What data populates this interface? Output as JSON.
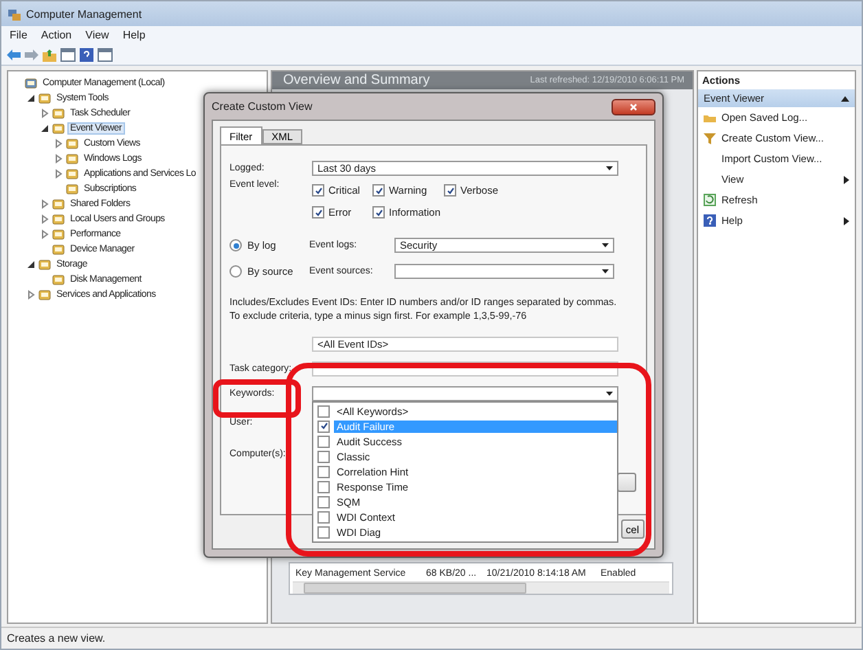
{
  "window": {
    "title": "Computer Management"
  },
  "menu": [
    "File",
    "Action",
    "View",
    "Help"
  ],
  "tree": [
    {
      "label": "Computer Management (Local)",
      "selected": false,
      "children": [
        {
          "label": "System Tools",
          "selected": false,
          "expanded": true,
          "children": [
            {
              "label": "Task Scheduler",
              "selected": false,
              "expanded": false
            },
            {
              "label": "Event Viewer",
              "selected": true,
              "expanded": true,
              "children": [
                {
                  "label": "Custom Views",
                  "selected": false,
                  "expanded": false
                },
                {
                  "label": "Windows Logs",
                  "selected": false,
                  "expanded": false
                },
                {
                  "label": "Applications and Services Lo",
                  "selected": false,
                  "expanded": false
                },
                {
                  "label": "Subscriptions",
                  "selected": false
                }
              ]
            },
            {
              "label": "Shared Folders",
              "selected": false,
              "expanded": false
            },
            {
              "label": "Local Users and Groups",
              "selected": false,
              "expanded": false
            },
            {
              "label": "Performance",
              "selected": false,
              "expanded": false
            },
            {
              "label": "Device Manager",
              "selected": false
            }
          ]
        },
        {
          "label": "Storage",
          "selected": false,
          "expanded": true,
          "children": [
            {
              "label": "Disk Management",
              "selected": false
            }
          ]
        },
        {
          "label": "Services and Applications",
          "selected": false,
          "expanded": false
        }
      ]
    }
  ],
  "center": {
    "title": "Overview and Summary",
    "refreshed": "Last refreshed: 12/19/2010 6:06:11 PM",
    "table_row": [
      "Key Management Service",
      "68 KB/20 ...",
      "10/21/2010 8:14:18 AM",
      "Enabled"
    ]
  },
  "dialog": {
    "title": "Create Custom View",
    "tabs": [
      {
        "label": "Filter",
        "selected": true
      },
      {
        "label": "XML",
        "selected": false
      }
    ],
    "logged": {
      "label": "Logged:",
      "value": "Last 30 days"
    },
    "event_level": {
      "label": "Event level:",
      "options": [
        {
          "label": "Critical",
          "checked": true
        },
        {
          "label": "Warning",
          "checked": true
        },
        {
          "label": "Verbose",
          "checked": true
        },
        {
          "label": "Error",
          "checked": true
        },
        {
          "label": "Information",
          "checked": true
        }
      ]
    },
    "sources": [
      {
        "label": "By log",
        "selected": true,
        "field_label": "Event logs:",
        "value": "Security"
      },
      {
        "label": "By source",
        "selected": false,
        "field_label": "Event sources:"
      }
    ],
    "description": "Includes/Excludes Event IDs: Enter ID numbers and/or ID ranges separated by commas. To exclude criteria, type a minus sign first. For example 1,3,5-99,-76",
    "event_ids": {
      "value": "<All Event IDs>"
    },
    "task_category": {
      "label": "Task category:"
    },
    "keywords": {
      "label": "Keywords:",
      "options": [
        {
          "label": "<All Keywords>",
          "checked": false,
          "selected": false
        },
        {
          "label": "Audit Failure",
          "checked": true,
          "selected": true
        },
        {
          "label": "Audit Success",
          "checked": false,
          "selected": false
        },
        {
          "label": "Classic",
          "checked": false,
          "selected": false
        },
        {
          "label": "Correlation Hint",
          "checked": false,
          "selected": false
        },
        {
          "label": "Response Time",
          "checked": false,
          "selected": false
        },
        {
          "label": "SQM",
          "checked": false,
          "selected": false
        },
        {
          "label": "WDI Context",
          "checked": false,
          "selected": false
        },
        {
          "label": "WDI Diag",
          "checked": false,
          "selected": false
        }
      ]
    },
    "user": {
      "label": "User:"
    },
    "computer": {
      "label": "Computer(s):"
    },
    "cancel_button": "cel"
  },
  "actions": {
    "title": "Actions",
    "section": "Event Viewer",
    "items": [
      {
        "label": "Open Saved Log...",
        "submenu": false
      },
      {
        "label": "Create Custom View...",
        "submenu": false
      },
      {
        "label": "Import Custom View...",
        "submenu": false
      },
      {
        "label": "View",
        "submenu": true
      },
      {
        "label": "Refresh",
        "submenu": false
      },
      {
        "label": "Help",
        "submenu": true
      }
    ]
  },
  "status_bar": "Creates a new view."
}
